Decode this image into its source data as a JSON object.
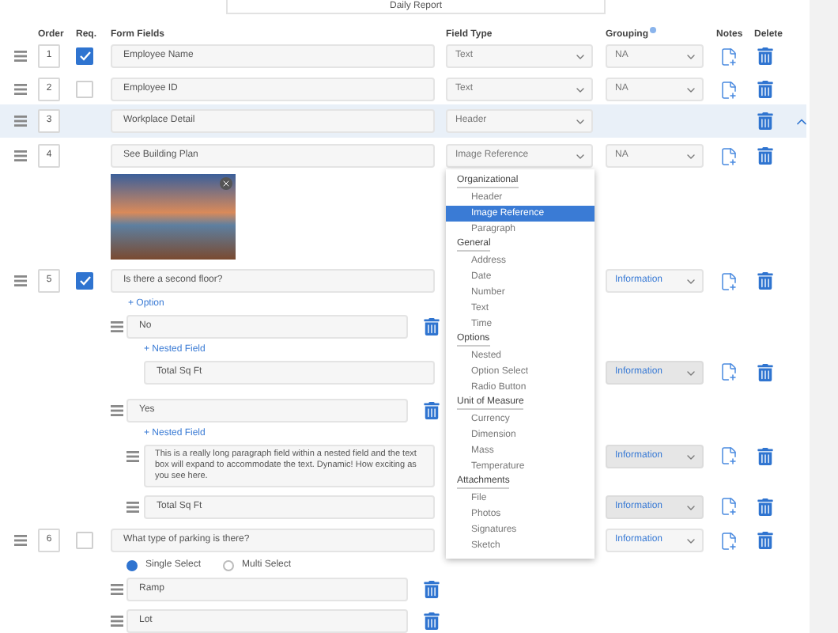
{
  "report_title": "Daily Report",
  "columns": [
    "Order",
    "Req.",
    "Form Fields",
    "Field Type",
    "Grouping",
    "Notes",
    "Delete"
  ],
  "rows": [
    {
      "kind": "field",
      "order": "1",
      "required": true,
      "value": "Employee Name",
      "field_type": "Text",
      "grouping": {
        "label": "NA",
        "default": true,
        "disabled": false
      }
    },
    {
      "kind": "field",
      "order": "2",
      "required": false,
      "value": "Employee ID",
      "field_type": "Text",
      "grouping": {
        "label": "NA",
        "default": true,
        "disabled": false
      }
    },
    {
      "kind": "header",
      "order": "3",
      "value": "Workplace Detail",
      "field_type": "Header",
      "expanded": true
    },
    {
      "kind": "image",
      "order": "4",
      "value": "See Building Plan",
      "field_type": "Image Reference",
      "grouping": {
        "label": "NA",
        "default": true,
        "disabled": false
      }
    },
    {
      "kind": "options",
      "order": "5",
      "required": true,
      "value": "Is there a second floor?",
      "grouping": {
        "label": "Information",
        "default": false,
        "disabled": false
      },
      "add_option": "+ Option",
      "options": [
        {
          "value": "No",
          "add_nested": "+ Nested Field",
          "nested": [
            {
              "kind": "field",
              "value": "Total Sq Ft",
              "grouping": {
                "label": "Information",
                "default": false,
                "disabled": true
              }
            }
          ]
        },
        {
          "value": "Yes",
          "add_nested": "+ Nested Field",
          "nested": [
            {
              "kind": "paragraph",
              "value": "This is a really long paragraph field within a nested field and the text box will expand to accommodate the text. Dynamic! How exciting as you see here.",
              "grouping": {
                "label": "Information",
                "default": false,
                "disabled": true
              }
            },
            {
              "kind": "field",
              "handle": true,
              "value": "Total Sq Ft",
              "grouping": {
                "label": "Information",
                "default": false,
                "disabled": true
              }
            }
          ]
        }
      ]
    },
    {
      "kind": "choice",
      "order": "6",
      "required": false,
      "value": "What type of parking is there?",
      "grouping": {
        "label": "Information",
        "default": false,
        "disabled": false
      },
      "modes": [
        {
          "label": "Single Select",
          "selected": true
        },
        {
          "label": "Multi Select",
          "selected": false
        }
      ],
      "options": [
        {
          "value": "Ramp"
        },
        {
          "value": "Lot"
        }
      ]
    }
  ],
  "dropdown": {
    "groups": [
      {
        "label": "Organizational",
        "items": [
          {
            "label": "Header",
            "selected": false
          },
          {
            "label": "Image Reference",
            "selected": true
          },
          {
            "label": "Paragraph",
            "selected": false
          }
        ]
      },
      {
        "label": "General",
        "items": [
          {
            "label": "Address",
            "selected": false
          },
          {
            "label": "Date",
            "selected": false
          },
          {
            "label": "Number",
            "selected": false
          },
          {
            "label": "Text",
            "selected": false
          },
          {
            "label": "Time",
            "selected": false
          }
        ]
      },
      {
        "label": "Options",
        "items": [
          {
            "label": "Nested",
            "selected": false
          },
          {
            "label": "Option Select",
            "selected": false
          },
          {
            "label": "Radio Button",
            "selected": false
          }
        ]
      },
      {
        "label": "Unit of Measure",
        "items": [
          {
            "label": "Currency",
            "selected": false
          },
          {
            "label": "Dimension",
            "selected": false
          },
          {
            "label": "Mass",
            "selected": false
          },
          {
            "label": "Temperature",
            "selected": false
          }
        ]
      },
      {
        "label": "Attachments",
        "items": [
          {
            "label": "File",
            "selected": false
          },
          {
            "label": "Photos",
            "selected": false
          },
          {
            "label": "Signatures",
            "selected": false
          },
          {
            "label": "Sketch",
            "selected": false
          }
        ]
      }
    ]
  }
}
